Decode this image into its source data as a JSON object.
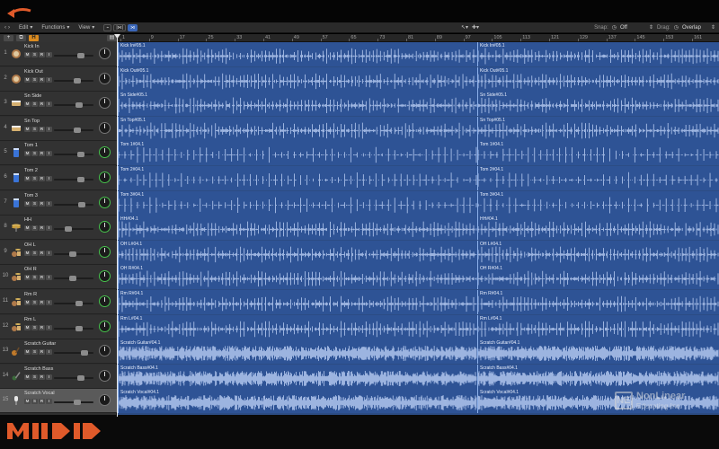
{
  "toolbar": {
    "edit": "Edit",
    "functions": "Functions",
    "view": "View",
    "snap_label": "Snap:",
    "snap_value": "Off",
    "drag_label": "Drag:",
    "drag_value": "Overlap"
  },
  "ruler": [
    "1",
    "9",
    "17",
    "25",
    "33",
    "41",
    "49",
    "57",
    "65",
    "73",
    "81",
    "89",
    "97",
    "105",
    "113",
    "121",
    "129",
    "137",
    "145",
    "153",
    "161",
    "169"
  ],
  "header_left": {
    "h_button": "H"
  },
  "tracks": [
    {
      "num": "1",
      "name": "Kick In",
      "icon": "kick-drum-icon",
      "pan_green": false,
      "selected": false
    },
    {
      "num": "2",
      "name": "Kick Out",
      "icon": "kick-drum-icon",
      "pan_green": false,
      "selected": false
    },
    {
      "num": "3",
      "name": "Sn Side",
      "icon": "snare-drum-icon",
      "pan_green": false,
      "selected": false
    },
    {
      "num": "4",
      "name": "Sn Top",
      "icon": "snare-drum-icon",
      "pan_green": false,
      "selected": false
    },
    {
      "num": "5",
      "name": "Tom 1",
      "icon": "tom-drum-icon",
      "pan_green": true,
      "selected": false
    },
    {
      "num": "6",
      "name": "Tom 2",
      "icon": "tom-drum-icon",
      "pan_green": true,
      "selected": false
    },
    {
      "num": "7",
      "name": "Tom 3",
      "icon": "tom-drum-icon",
      "pan_green": true,
      "selected": false
    },
    {
      "num": "8",
      "name": "HH",
      "icon": "hihat-icon",
      "pan_green": true,
      "selected": false
    },
    {
      "num": "9",
      "name": "OH L",
      "icon": "drum-kit-icon",
      "pan_green": true,
      "selected": false
    },
    {
      "num": "10",
      "name": "OH R",
      "icon": "drum-kit-icon",
      "pan_green": true,
      "selected": false
    },
    {
      "num": "11",
      "name": "Rm R",
      "icon": "drum-kit-icon",
      "pan_green": true,
      "selected": false
    },
    {
      "num": "12",
      "name": "Rm L",
      "icon": "drum-kit-icon",
      "pan_green": true,
      "selected": false
    },
    {
      "num": "13",
      "name": "Scratch Guitar",
      "icon": "guitar-icon",
      "pan_green": false,
      "selected": false
    },
    {
      "num": "14",
      "name": "Scratch Bass",
      "icon": "bass-guitar-icon",
      "pan_green": false,
      "selected": false
    },
    {
      "num": "15",
      "name": "Scratch Vocal",
      "icon": "microphone-icon",
      "pan_green": false,
      "selected": true
    }
  ],
  "track_buttons": {
    "mute": "M",
    "solo": "S",
    "record": "R",
    "input": "I"
  },
  "fader_levels": [
    0.72,
    0.6,
    0.68,
    0.6,
    0.72,
    0.72,
    0.75,
    0.34,
    0.47,
    0.47,
    0.68,
    0.68,
    0.82,
    0.72,
    0.62
  ],
  "regions": [
    [
      "Kick In#05.1",
      "Kick In#05.1"
    ],
    [
      "Kick Out#05.1",
      "Kick Out#05.1"
    ],
    [
      "Sn Side#05.1",
      "Sn Side#05.1"
    ],
    [
      "Sn Top#05.1",
      "Sn Top#05.1"
    ],
    [
      "Tom 1#04.1",
      "Tom 1#04.1"
    ],
    [
      "Tom 2#04.1",
      "Tom 2#04.1"
    ],
    [
      "Tom 3#04.1",
      "Tom 3#04.1"
    ],
    [
      "HH#04.1",
      "HH#04.1"
    ],
    [
      "OH L#04.1",
      "OH L#04.1"
    ],
    [
      "OH R#04.1",
      "OH R#04.1"
    ],
    [
      "Rm R#04.1",
      "Rm R#04.1"
    ],
    [
      "Rm L#04.1",
      "Rm L#04.1"
    ],
    [
      "Scratch Guitar#04.1",
      "Scratch Guitar#04.1"
    ],
    [
      "Scratch Bass#04.1",
      "Scratch Bass#04.1"
    ],
    [
      "Scratch Vocal#04.1",
      "Scratch Vocal#04.1"
    ]
  ],
  "watermark": {
    "logo": "NE",
    "line1": "NonLinear",
    "line2": "Educating Inc."
  },
  "colors": {
    "region": "#2e5395",
    "waveform": "#b9cdf3",
    "accent": "#3a66b8",
    "h_button": "#d98a1f"
  }
}
